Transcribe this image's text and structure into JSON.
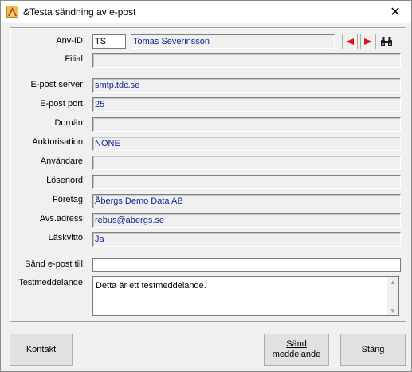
{
  "window": {
    "title": "&Testa sändning av e-post",
    "close_glyph": "✕"
  },
  "form": {
    "anv_id": {
      "label": "Anv-ID:",
      "code": "TS",
      "name": "Tomas Severinsson"
    },
    "filial": {
      "label": "Filial:",
      "value": ""
    },
    "epost_server": {
      "label": "E-post server:",
      "value": "smtp.tdc.se"
    },
    "epost_port": {
      "label": "E-post port:",
      "value": "25"
    },
    "doman": {
      "label": "Domän:",
      "value": ""
    },
    "auktorisation": {
      "label": "Auktorisation:",
      "value": "NONE"
    },
    "anvandare": {
      "label": "Användare:",
      "value": ""
    },
    "losenord": {
      "label": "Lösenord:",
      "value": ""
    },
    "foretag": {
      "label": "Företag:",
      "value": "Åbergs Demo Data AB"
    },
    "avs_adress": {
      "label": "Avs.adress:",
      "value": "rebus@abergs.se"
    },
    "laskvitto": {
      "label": "Läskvitto:",
      "value": "Ja"
    },
    "sand_till": {
      "label": "Sänd e-post till:",
      "value": ""
    },
    "testmeddelande": {
      "label": "Testmeddelande:",
      "value": "Detta är ett testmeddelande."
    }
  },
  "buttons": {
    "kontakt": "Kontakt",
    "sand_line1": "Sänd",
    "sand_line2": "meddelande",
    "stang": "Stäng"
  },
  "colors": {
    "value_text": "#0b2a8a",
    "nav_arrow": "#e0141e"
  },
  "icons": [
    "app-icon",
    "prev-arrow-icon",
    "next-arrow-icon",
    "binoculars-icon",
    "close-icon"
  ]
}
